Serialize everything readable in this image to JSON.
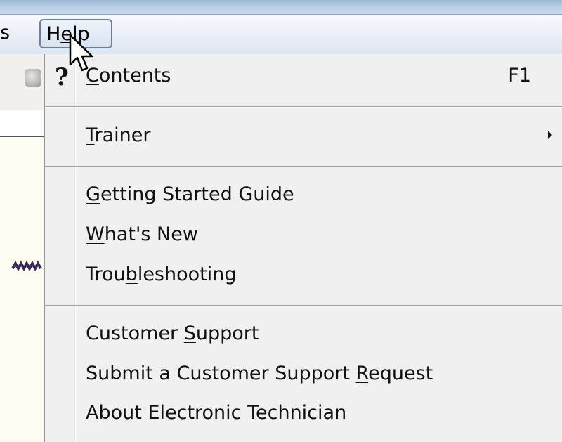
{
  "menubar": {
    "prev_menu_label": "s",
    "help_menu": {
      "label_before": "H",
      "label_underlined": "e",
      "label_after": "lp"
    }
  },
  "help_menu_items": [
    {
      "id": "contents",
      "before": "",
      "mnemonic": "C",
      "after": "ontents",
      "shortcut": "F1",
      "icon": "help-question-icon"
    },
    {
      "id": "trainer",
      "before": "",
      "mnemonic": "T",
      "after": "rainer",
      "submenu": true
    },
    {
      "id": "getting-started",
      "before": "",
      "mnemonic": "G",
      "after": "etting Started Guide"
    },
    {
      "id": "whats-new",
      "before": "",
      "mnemonic": "W",
      "after": "hat's New"
    },
    {
      "id": "troubleshooting",
      "before": "Trou",
      "mnemonic": "b",
      "after": "leshooting"
    },
    {
      "id": "customer-support",
      "before": "Customer ",
      "mnemonic": "S",
      "after": "upport"
    },
    {
      "id": "submit-request",
      "before": "Submit a Customer Support ",
      "mnemonic": "R",
      "after": "equest"
    },
    {
      "id": "about",
      "before": "",
      "mnemonic": "A",
      "after": "bout Electronic Technician"
    }
  ],
  "icons": {
    "help": "?",
    "submenu_arrow": "submenu-arrow-icon",
    "cursor": "mouse-pointer-icon"
  },
  "colors": {
    "menu_background": "#f0f0f0",
    "menubar_highlight_border": "#6a7f99",
    "separator": "#a0a0a0"
  }
}
